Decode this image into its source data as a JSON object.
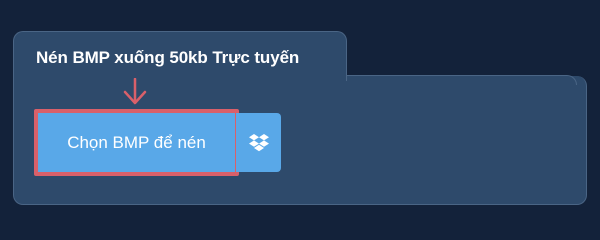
{
  "tab": {
    "title": "Nén BMP xuống 50kb Trực tuyến"
  },
  "upload": {
    "choose_label": "Chọn BMP để nén",
    "dropbox_icon": "dropbox-icon",
    "arrow_icon": "arrow-down-icon"
  },
  "colors": {
    "background": "#13223a",
    "panel": "#2e4a6b",
    "button": "#59a8e8",
    "highlight": "#d9606a"
  }
}
